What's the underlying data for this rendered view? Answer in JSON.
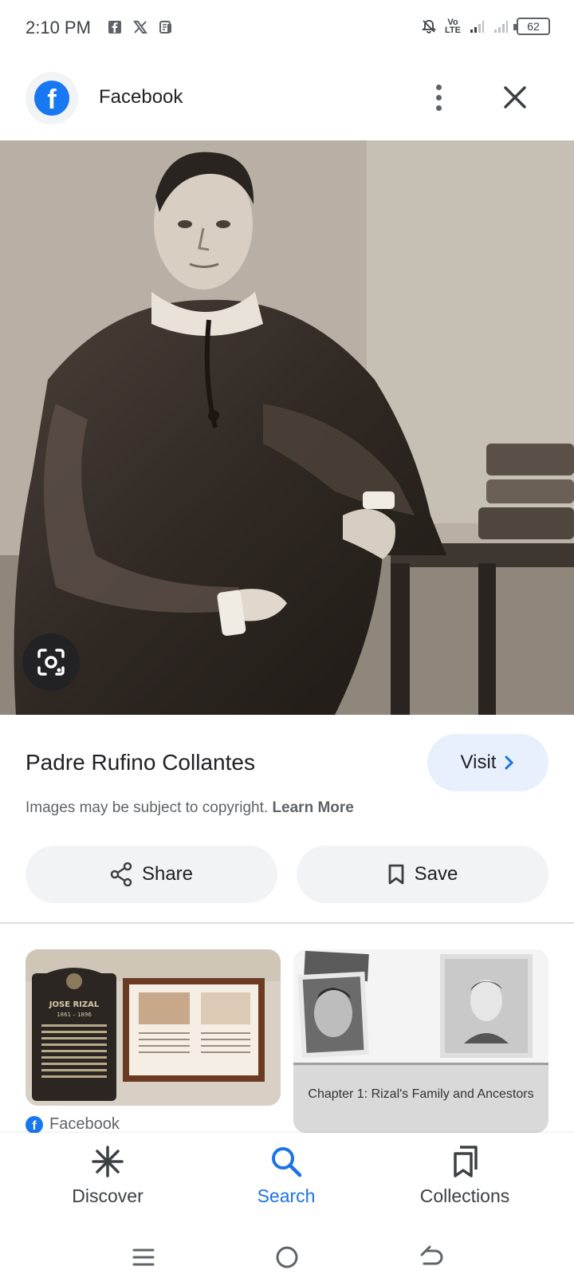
{
  "status_bar": {
    "time": "2:10 PM",
    "left_icons": [
      "facebook-icon",
      "x-icon",
      "news-icon"
    ],
    "right_icons": [
      "mute-icon",
      "volte-icon",
      "signal-icon",
      "signal-icon"
    ],
    "lte_label": "Vo\nLTE",
    "battery": "62"
  },
  "header": {
    "title": "Facebook",
    "logo_letter": "f",
    "brand_color": "#1877f2"
  },
  "image": {
    "alt": "Sepia portrait photograph"
  },
  "info": {
    "title": "Padre Rufino Collantes",
    "visit_label": "Visit",
    "copyright_text": "Images may be subject to copyright.",
    "learn_more": "Learn More"
  },
  "actions": {
    "share_label": "Share",
    "save_label": "Save"
  },
  "related": {
    "card1_plaque_title": "JOSE RIZAL",
    "card1_plaque_years": "1861 – 1896",
    "card2_caption": "Chapter 1: Rizal's Family and Ancestors",
    "card1_source": "Facebook"
  },
  "bottom_nav": {
    "items": [
      {
        "label": "Discover",
        "icon": "asterisk-icon"
      },
      {
        "label": "Search",
        "icon": "search-icon",
        "active": true
      },
      {
        "label": "Collections",
        "icon": "bookmarks-icon"
      }
    ],
    "active_color": "#1a73e8"
  }
}
